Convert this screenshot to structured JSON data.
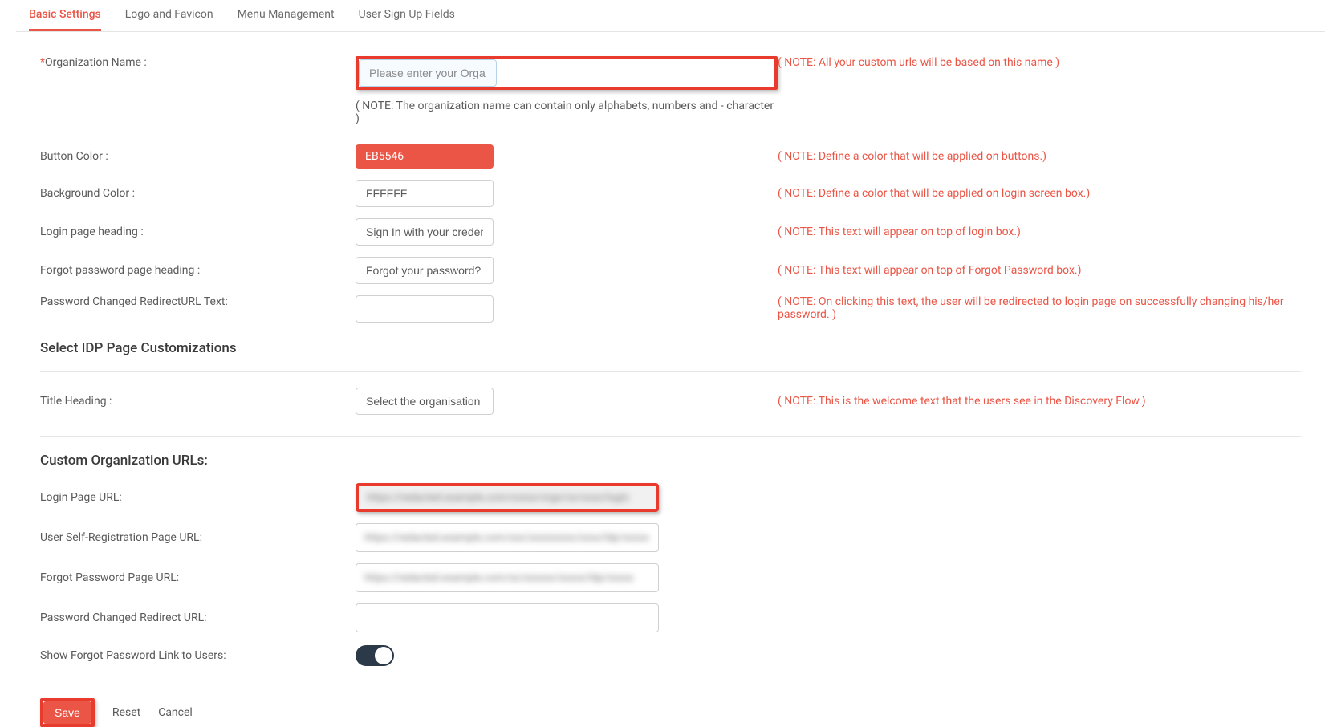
{
  "tabs": {
    "basic": "Basic Settings",
    "logo": "Logo and Favicon",
    "menu": "Menu Management",
    "signup": "User Sign Up Fields"
  },
  "fields": {
    "org_name": {
      "label": "Organization Name :",
      "placeholder": "Please enter your Organi",
      "note_below": "( NOTE: The organization name can contain only alphabets, numbers and - character )",
      "note_right": "( NOTE: All your custom urls will be based on this name )"
    },
    "button_color": {
      "label": "Button Color :",
      "value": "EB5546",
      "note_right": "( NOTE: Define a color that will be applied on buttons.)"
    },
    "bg_color": {
      "label": "Background Color :",
      "value": "FFFFFF",
      "note_right": "( NOTE: Define a color that will be applied on login screen box.)"
    },
    "login_heading": {
      "label": "Login page heading :",
      "value": "Sign In with your credent",
      "note_right": "( NOTE: This text will appear on top of login box.)"
    },
    "forgot_heading": {
      "label": "Forgot password page heading :",
      "value": "Forgot your password?",
      "note_right": "( NOTE: This text will appear on top of Forgot Password box.)"
    },
    "pwd_redirect_text": {
      "label": "Password Changed RedirectURL Text:",
      "value": "",
      "note_right": "( NOTE: On clicking this text, the user will be redirected to login page on successfully changing his/her password. )"
    }
  },
  "idp_section": {
    "header": "Select IDP Page Customizations",
    "title_heading": {
      "label": "Title Heading :",
      "value": "Select the organisation y",
      "note_right": "( NOTE: This is the welcome text that the users see in the Discovery Flow.)"
    }
  },
  "urls_section": {
    "header": "Custom Organization URLs:",
    "login_url": {
      "label": "Login Page URL:",
      "value": "https://redacted.example.com/xxxxx/orgn/xx/xxxx/login"
    },
    "self_reg_url": {
      "label": "User Self-Registration Page URL:",
      "value": "https://redacted.example.com/xxx/xxxxxxxxx/xxxx/ldp/xxxxx"
    },
    "forgot_url": {
      "label": "Forgot Password Page URL:",
      "value": "https://redacted.example.com/xx/xxxxxx/xxxxx/ldp/xxxxx"
    },
    "pwd_changed_url": {
      "label": "Password Changed Redirect URL:",
      "value": ""
    },
    "show_forgot": {
      "label": "Show Forgot Password Link to Users:"
    }
  },
  "actions": {
    "save": "Save",
    "reset": "Reset",
    "cancel": "Cancel"
  }
}
